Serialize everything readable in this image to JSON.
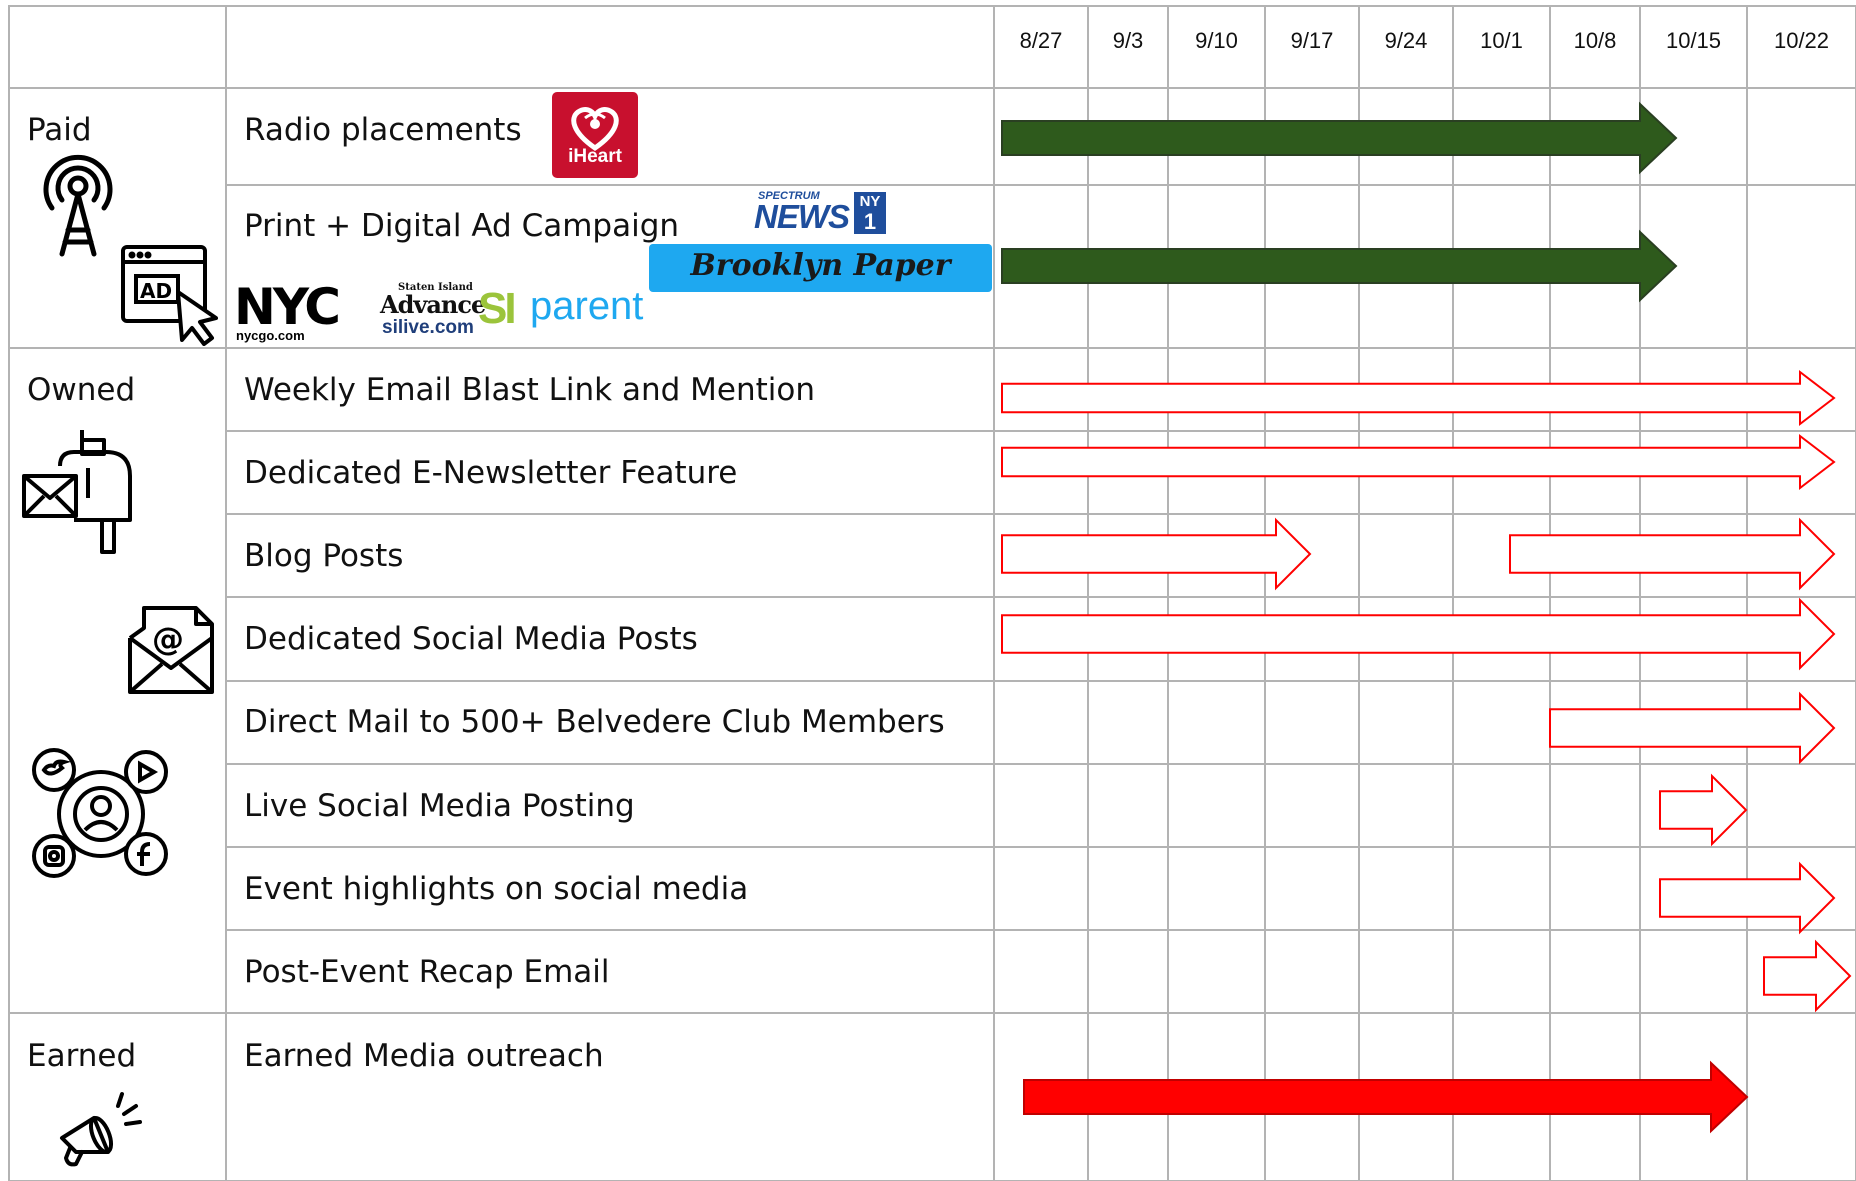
{
  "weeks": [
    "8/27",
    "9/3",
    "9/10",
    "9/17",
    "9/24",
    "10/1",
    "10/8",
    "10/15",
    "10/22"
  ],
  "groups": [
    {
      "label": "Paid",
      "icon": "radio-tower-icon"
    },
    {
      "label": "Owned",
      "icon": "mailbox-icon"
    },
    {
      "label": "Earned",
      "icon": "megaphone-icon"
    }
  ],
  "rows": [
    {
      "label": "Radio placements"
    },
    {
      "label": "Print + Digital Ad Campaign"
    },
    {
      "label": "Weekly Email Blast Link and Mention"
    },
    {
      "label": "Dedicated E-Newsletter Feature"
    },
    {
      "label": "Blog Posts"
    },
    {
      "label": "Dedicated Social Media Posts"
    },
    {
      "label": "Direct Mail to 500+ Belvedere Club Members"
    },
    {
      "label": "Live Social Media Posting"
    },
    {
      "label": "Event highlights on social media"
    },
    {
      "label": "Post-Event Recap Email"
    },
    {
      "label": "Earned Media outreach"
    }
  ],
  "logos": {
    "iheart": "iHeart",
    "spectrum_small": "SPECTRUM",
    "spectrum_news": "NEWS",
    "spectrum_ny": "NY",
    "spectrum_1": "1",
    "brooklyn_paper": "Brooklyn Paper",
    "nyc": "NYC",
    "nycgo": "nycgo.com",
    "staten_island": "Staten Island",
    "advance": "Advance",
    "silive": "silive.com",
    "si": "SI",
    "parent": "parent"
  },
  "colors": {
    "paid_bar": "#2e5a1c",
    "outline_bar": "#ff0000",
    "earned_bar": "#ff0000",
    "grid": "#b3b3b3",
    "brooklyn_bg": "#1ea8f0",
    "iheart_bg": "#c8102e",
    "spectrum_blue": "#1f4e9c"
  },
  "chart_data": {
    "type": "table",
    "x_axis": "week",
    "categories": [
      "8/27",
      "9/3",
      "9/10",
      "9/17",
      "9/24",
      "10/1",
      "10/8",
      "10/15",
      "10/22"
    ],
    "tasks": [
      {
        "row": 0,
        "bars": [
          {
            "start": "8/27",
            "end": "10/15",
            "style": "solid-green"
          }
        ]
      },
      {
        "row": 1,
        "bars": [
          {
            "start": "8/27",
            "end": "10/15",
            "style": "solid-green"
          }
        ]
      },
      {
        "row": 2,
        "bars": [
          {
            "start": "8/27",
            "end": "10/22",
            "style": "outline-red"
          }
        ]
      },
      {
        "row": 3,
        "bars": [
          {
            "start": "8/27",
            "end": "10/22",
            "style": "outline-red"
          }
        ]
      },
      {
        "row": 4,
        "bars": [
          {
            "start": "8/27",
            "end": "9/17",
            "style": "outline-red"
          },
          {
            "start": "10/1",
            "end": "10/22",
            "style": "outline-red"
          }
        ]
      },
      {
        "row": 5,
        "bars": [
          {
            "start": "8/27",
            "end": "10/22",
            "style": "outline-red"
          }
        ]
      },
      {
        "row": 6,
        "bars": [
          {
            "start": "10/8",
            "end": "10/22",
            "style": "outline-red"
          }
        ]
      },
      {
        "row": 7,
        "bars": [
          {
            "start": "10/15",
            "end": "10/15",
            "style": "outline-red"
          }
        ]
      },
      {
        "row": 8,
        "bars": [
          {
            "start": "10/15",
            "end": "10/22",
            "style": "outline-red"
          }
        ]
      },
      {
        "row": 9,
        "bars": [
          {
            "start": "10/22",
            "end": "10/22",
            "style": "outline-red"
          }
        ]
      },
      {
        "row": 10,
        "bars": [
          {
            "start": "8/27",
            "end": "10/15",
            "style": "solid-red"
          }
        ]
      }
    ]
  }
}
